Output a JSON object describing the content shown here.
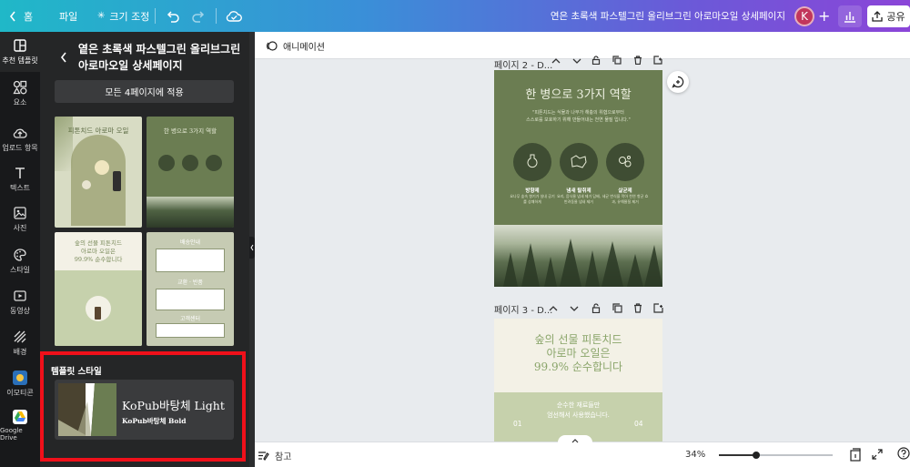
{
  "topbar": {
    "home_label": "홈",
    "file_label": "파일",
    "resize_label": "크기 조정",
    "doc_title": "연은 초록색 파스텔그린 올리브그린 아로마오일 상세페이지",
    "avatar_letter": "K",
    "share_label": "공유",
    "accent_gradient": [
      "#20b8c8",
      "#8b45d8"
    ]
  },
  "rail": {
    "items": [
      {
        "label": "추천 템플릿",
        "icon": "template-icon"
      },
      {
        "label": "요소",
        "icon": "elements-icon"
      },
      {
        "label": "업로드 항목",
        "icon": "upload-icon"
      },
      {
        "label": "텍스트",
        "icon": "text-icon"
      },
      {
        "label": "사진",
        "icon": "photo-icon"
      },
      {
        "label": "스타일",
        "icon": "palette-icon"
      },
      {
        "label": "동영상",
        "icon": "video-icon"
      },
      {
        "label": "배경",
        "icon": "background-icon"
      },
      {
        "label": "이모티콘",
        "icon": "emoji-app-icon"
      },
      {
        "label": "Google Drive",
        "icon": "google-drive-icon"
      }
    ]
  },
  "panel": {
    "title": "옅은 초록색 파스텔그린 올리브그린 아로마오일 상세페이지",
    "apply_label": "모든 4페이지에 적용",
    "thumb1": {
      "title": "피톤치드 아로마 오일"
    },
    "thumb2": {
      "title": "한 병으로 3가지 역할"
    },
    "thumb3": {
      "line1": "숲의 선물 피톤치드",
      "line2": "아로마 오일은",
      "line3": "99.9% 순수합니다"
    },
    "thumb4": {
      "heading": "배송안내",
      "section": "교환 · 반품",
      "footer": "고객센터"
    },
    "style_heading": "템플릿 스타일",
    "font_primary": "KoPub바탕체 Light",
    "font_secondary": "KoPub바탕체 Bold",
    "palette": [
      "#4a4330",
      "#a8a88a",
      "#ffffff",
      "#6b7d52"
    ]
  },
  "subbar": {
    "animation_label": "애니메이션"
  },
  "page2": {
    "label": "페이지 2 - D...",
    "title": "한 병으로 3가지 역할",
    "desc_line1": "\"피톤치드는 식물과 나무가 해충의 위협으로부터",
    "desc_line2": "스스로를 보호하기 위해 만들어내는 천연 물질 입니다.\"",
    "roles": [
      {
        "name": "방향제",
        "desc": "요나무 숲속 향기가 실내 공기를 상쾌하게"
      },
      {
        "name": "냄새 탈취제",
        "desc": "요리, 음식물 냄새 제거 담배, 반려동물 냄새 제거"
      },
      {
        "name": "살균제",
        "desc": "세균 번식을 막아 천연 항균 효과, 유해물질 제거"
      }
    ]
  },
  "page3": {
    "label": "페이지 3 - D...",
    "line1": "숲의 선물 피톤치드",
    "line2": "아로마 오일은",
    "line3": "99.9% 순수합니다",
    "sub1": "순수한 재료들만",
    "sub2": "엄선해서 사용했습니다.",
    "num_left": "01",
    "num_right": "04"
  },
  "bottombar": {
    "notes_label": "참고",
    "zoom": "34%",
    "zoom_fraction": 0.33
  },
  "colors": {
    "olive": "#6b7d52",
    "olive_dark": "#3f4d33",
    "cream": "#f3f1e6",
    "highlight_red": "#f0101a"
  }
}
